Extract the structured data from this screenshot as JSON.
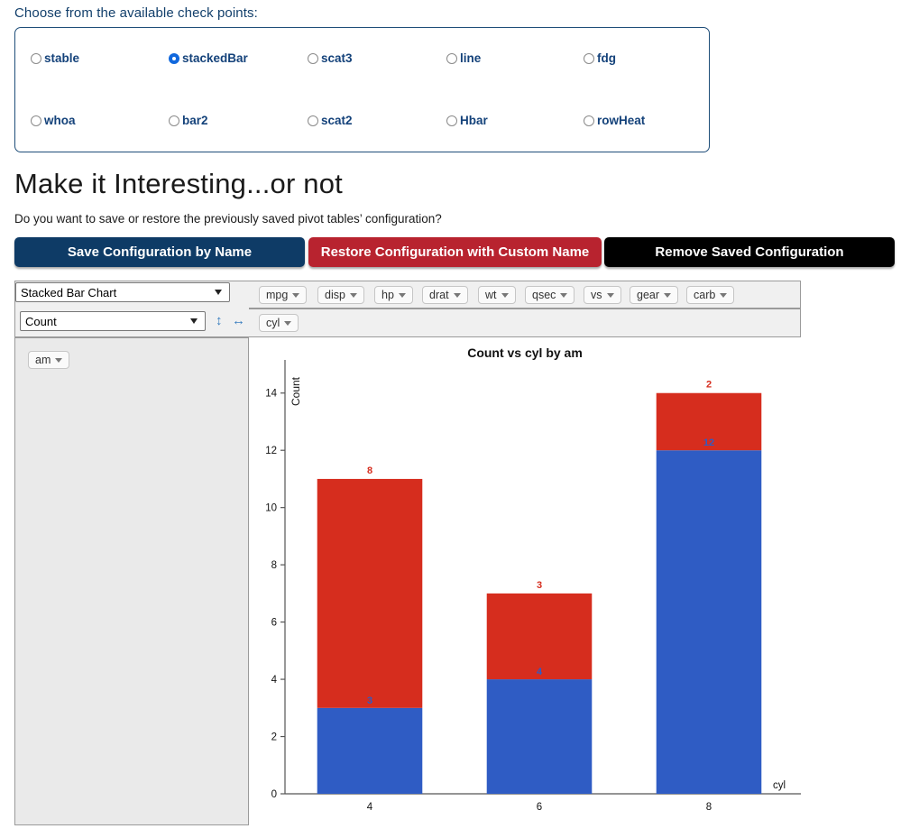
{
  "checkpoints": {
    "legend": "Choose from the available check points:",
    "items": [
      {
        "label": "stable",
        "selected": false
      },
      {
        "label": "stackedBar",
        "selected": true
      },
      {
        "label": "scat3",
        "selected": false
      },
      {
        "label": "line",
        "selected": false
      },
      {
        "label": "fdg",
        "selected": false
      },
      {
        "label": "whoa",
        "selected": false
      },
      {
        "label": "bar2",
        "selected": false
      },
      {
        "label": "scat2",
        "selected": false
      },
      {
        "label": "Hbar",
        "selected": false
      },
      {
        "label": "rowHeat",
        "selected": false
      }
    ]
  },
  "heading": {
    "title": "Make it Interesting...or not",
    "subtitle": "Do you want to save or restore the previously saved pivot tables’ configuration?"
  },
  "buttons": {
    "save": "Save Configuration by Name",
    "restore": "Restore Configuration with Custom Name",
    "remove": "Remove Saved Configuration",
    "save_color": "#0e3b66",
    "restore_color": "#b8232f",
    "remove_color": "#000000"
  },
  "pivot": {
    "renderer": "Stacked Bar Chart",
    "renderer_options": [
      "Stacked Bar Chart"
    ],
    "aggregator": "Count",
    "aggregator_options": [
      "Count"
    ],
    "sort_vertical_icon": "↕",
    "sort_horizontal_icon": "↔",
    "unused_fields": [
      "mpg",
      "disp",
      "hp",
      "drat",
      "wt",
      "qsec",
      "vs",
      "gear",
      "carb"
    ],
    "column_fields": [
      "cyl"
    ],
    "row_fields": [
      "am"
    ]
  },
  "chart_data": {
    "type": "bar",
    "stacked": true,
    "title": "Count vs cyl by am",
    "xlabel": "cyl",
    "ylabel": "Count",
    "categories": [
      "4",
      "6",
      "8"
    ],
    "ylim": [
      0,
      15
    ],
    "yticks": [
      0,
      2,
      4,
      6,
      8,
      10,
      12,
      14
    ],
    "grid": false,
    "legend": "none",
    "series": [
      {
        "name": "blue",
        "color": "#2f5cc4",
        "values": [
          3,
          4,
          12
        ]
      },
      {
        "name": "red",
        "color": "#d62d1e",
        "values": [
          8,
          3,
          2
        ]
      }
    ],
    "totals": [
      11,
      7,
      14
    ]
  }
}
